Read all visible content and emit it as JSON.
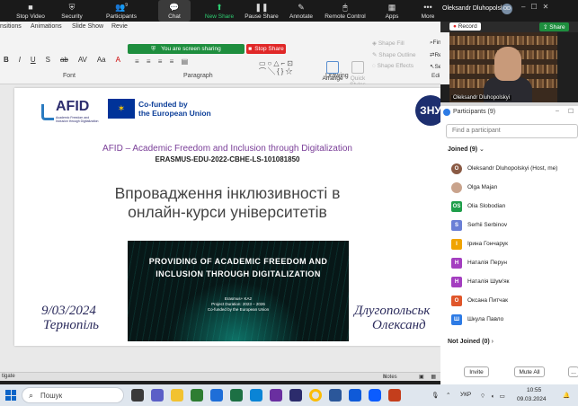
{
  "zoom_toolbar": {
    "stop_video": "Stop Video",
    "security": "Security",
    "participants": "Participants",
    "participants_count": "9",
    "chat": "Chat",
    "new_share": "New Share",
    "pause_share": "Pause Share",
    "annotate": "Annotate",
    "remote_control": "Remote Control",
    "apps": "Apps",
    "more": "More",
    "host_name": "Oleksandr Dluhopolskyi",
    "host_initials": "OD"
  },
  "ribbon": {
    "tabs": [
      "nsitions",
      "Animations",
      "Slide Show",
      "Revie"
    ],
    "sharing_banner": "You are screen sharing",
    "stop_share": "Stop Share",
    "format_buttons": [
      "B",
      "I",
      "U",
      "S",
      "ab",
      "AV",
      "Aa",
      "A"
    ],
    "group_font": "Font",
    "group_paragraph": "Paragraph",
    "group_drawing": "Drawing",
    "shape_fill": "Shape Fill",
    "shape_outline": "Shape Outline",
    "shape_effects": "Shape Effects",
    "arrange": "Arrange",
    "quick_styles": "Quick Styles",
    "find": "Find",
    "replace": "Rep",
    "select": "Sel",
    "editing": "Edi"
  },
  "slide": {
    "afid_logo_word": "AFID",
    "afid_logo_sub": "Academic Freedom and Inclusion through Digitalization",
    "eu_text_line1": "Co-funded by",
    "eu_text_line2": "the European Union",
    "zhu_badge": "ЗНУ",
    "afid_title": "AFID – Academic Freedom and Inclusion through Digitalization",
    "erasmus_id": "ERASMUS-EDU-2022-CBHE-LS-101081850",
    "ua_title_line1": "Впровадження інклюзивності в",
    "ua_title_line2": "онлайн-курси університетів",
    "banner_title_line1": "PROVIDING OF ACADEMIC FREEDOM AND",
    "banner_title_line2": "INCLUSION THROUGH DIGITALIZATION",
    "banner_info_line1": "Erasmus+ KA2",
    "banner_info_line2": "Project Duration: 2023 – 2026",
    "banner_info_line3": "Co-funded by the European Union",
    "date": "9/03/2024",
    "city": "Тернопіль",
    "author_line1": "Длугопольськ",
    "author_line2": "Олександ"
  },
  "statusbar": {
    "left": "tigate",
    "notes": "Notes"
  },
  "right_panel": {
    "record": "Record",
    "share": "Share",
    "video_name": "Oleksandr Dluhopolskyi",
    "participants_title": "Participants (9)",
    "search_placeholder": "Find a participant",
    "joined_label": "Joined",
    "joined_count": "(9)",
    "not_joined_label": "Not Joined (0)",
    "invite": "Invite",
    "mute_all": "Mute All",
    "more": "..."
  },
  "participants": [
    {
      "initials": "O",
      "name": "Oleksandr Dluhopolskyi (Host, me)",
      "color": "#8a5a44"
    },
    {
      "initials": "",
      "name": "Olga Majan",
      "color": "#c9a38c"
    },
    {
      "initials": "OS",
      "name": "Olia Slobodian",
      "color": "#1e9e4a"
    },
    {
      "initials": "S",
      "name": "Serhii Serbinov",
      "color": "#6a7fd6"
    },
    {
      "initials": "І",
      "name": "Ірина Гончарук",
      "color": "#f0a400"
    },
    {
      "initials": "Н",
      "name": "Наталія Перун",
      "color": "#a43ec0"
    },
    {
      "initials": "Н",
      "name": "Наталія Шум'як",
      "color": "#a43ec0"
    },
    {
      "initials": "О",
      "name": "Оксана Питчак",
      "color": "#e0562a"
    },
    {
      "initials": "Ш",
      "name": "Шкула Павло",
      "color": "#2d7be5"
    }
  ],
  "taskbar": {
    "search_text": "Пошук",
    "language": "УКР",
    "time": "10:55",
    "date": "09.03.2024"
  },
  "colors": {
    "zoom_dark": "#1a1a1a",
    "zoom_green": "#1e8e3e",
    "stop_red": "#e02828",
    "afid_purple": "#7a3e98",
    "eu_blue": "#003399"
  }
}
